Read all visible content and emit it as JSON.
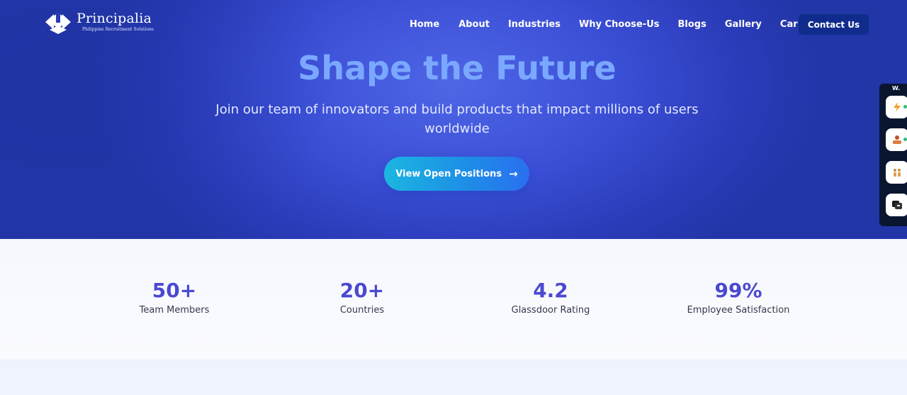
{
  "brand": {
    "name": "Principalia",
    "tagline": "Philippine Recruitment Solutions"
  },
  "nav": {
    "items": [
      "Home",
      "About",
      "Industries",
      "Why Choose-Us",
      "Blogs",
      "Gallery",
      "Careers"
    ],
    "contact_label": "Contact Us"
  },
  "hero": {
    "title": "Shape the Future",
    "subtitle": "Join our team of innovators and build products that impact millions of users worldwide",
    "cta_label": "View Open Positions"
  },
  "side_widget": {
    "label": "W.",
    "items": [
      "lightning-icon",
      "person-icon",
      "people-icon",
      "chat-icon"
    ]
  },
  "stats": [
    {
      "value": "50+",
      "label": "Team Members"
    },
    {
      "value": "20+",
      "label": "Countries"
    },
    {
      "value": "4.2",
      "label": "Glassdoor Rating"
    },
    {
      "value": "99%",
      "label": "Employee Satisfaction"
    }
  ],
  "colors": {
    "hero_bg": "#3b4fd6",
    "title": "#7aa8ff",
    "stat_value": "#4b49cf",
    "contact_btn": "#0f2c8c"
  }
}
